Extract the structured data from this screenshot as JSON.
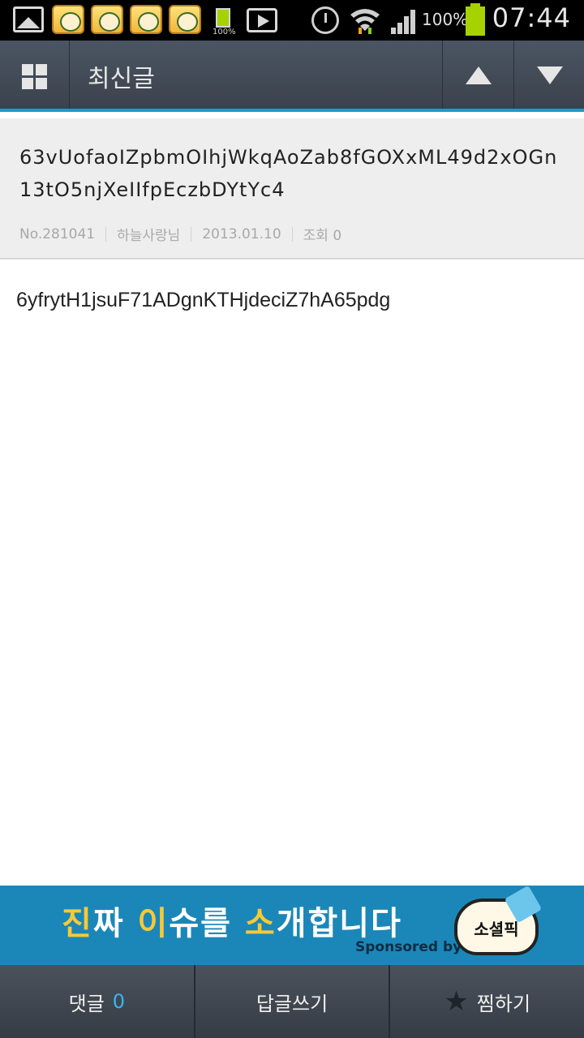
{
  "status_bar": {
    "battery_small_label": "100%",
    "battery_percent": "100%",
    "time": "07:44"
  },
  "action_bar": {
    "title": "최신글"
  },
  "post": {
    "title": "63vUofaoIZpbmOIhjWkqAoZab8fGOXxML49d2xOGn13tO5njXeIIfpEczbDYtYc4",
    "number": "No.281041",
    "author": "하늘사랑님",
    "date": "2013.01.10",
    "views": "조회 0",
    "body": "6yfrytH1jsuF71ADgnKTHjdeciZ7hA65pdg"
  },
  "ad": {
    "headline_1": "진",
    "headline_2": "짜 ",
    "headline_3": "이",
    "headline_4": "슈를 ",
    "headline_5": "소",
    "headline_6": "개합니다",
    "sponsored": "Sponsored by",
    "brand": "소셜픽"
  },
  "bottom_bar": {
    "comments_label": "댓글",
    "comments_count": "0",
    "reply_label": "답글쓰기",
    "bookmark_label": "찜하기"
  },
  "colors": {
    "accent": "#1b9bd1",
    "ad_background": "#1b87b8",
    "count": "#39b4f0"
  }
}
